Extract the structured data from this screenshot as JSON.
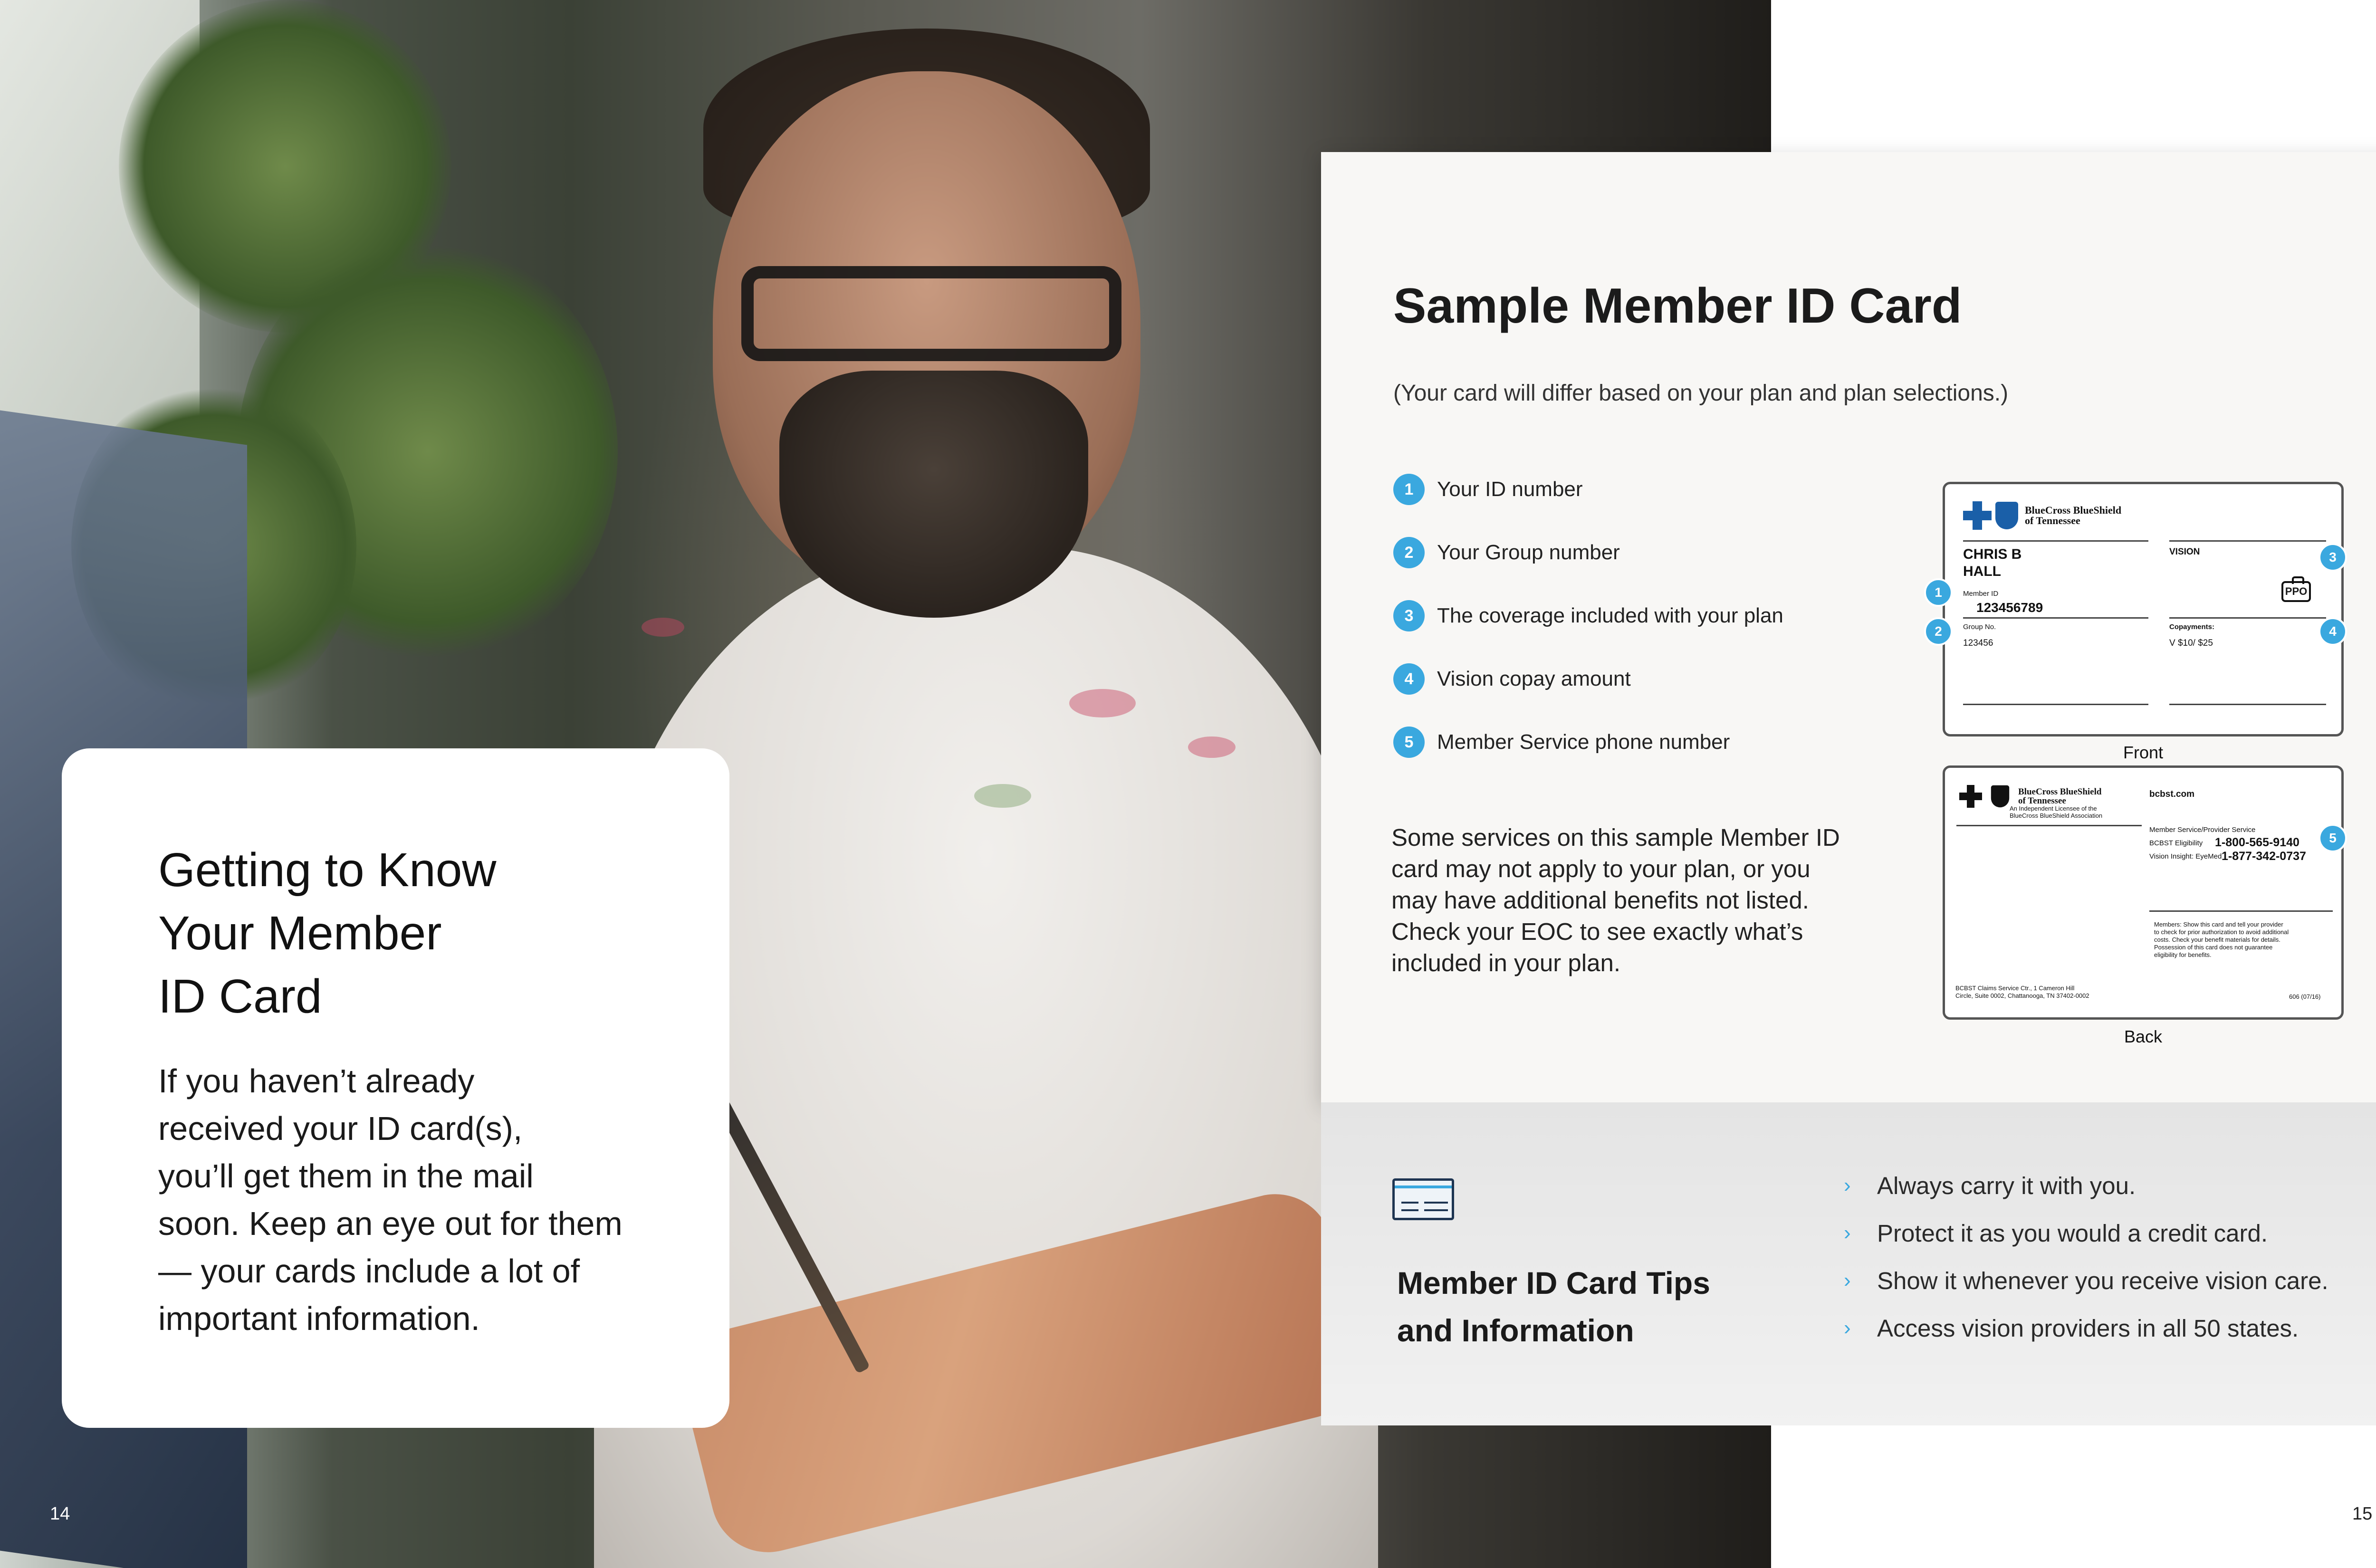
{
  "page_numbers": {
    "left": "14",
    "right": "15"
  },
  "intro": {
    "title": "Getting to Know\nYour Member\nID Card",
    "body": "If you haven’t already\nreceived your ID card(s),\nyou’ll get them in the mail\nsoon. Keep an eye out for them\n— your cards include a lot of\nimportant information."
  },
  "sample": {
    "title": "Sample Member ID Card",
    "subtitle": "(Your card will differ based on your plan and plan selections.)",
    "legend": [
      {
        "num": "1",
        "label": "Your ID number"
      },
      {
        "num": "2",
        "label": "Your Group number"
      },
      {
        "num": "3",
        "label": "The coverage included with your plan"
      },
      {
        "num": "4",
        "label": "Vision copay amount"
      },
      {
        "num": "5",
        "label": "Member Service phone number"
      }
    ],
    "note": "Some services on this sample Member ID\ncard may not apply to your plan, or you\nmay have additional benefits not listed.\nCheck your EOC to see exactly what’s\nincluded in your plan."
  },
  "card_front": {
    "caption": "Front",
    "logo_text": "BlueCross BlueShield\nof Tennessee",
    "member_name": "CHRIS B\nHALL",
    "coverage": "VISION",
    "plan_badge": "PPO",
    "member_id_label": "Member ID",
    "member_id": "123456789",
    "group_label": "Group No.",
    "group_no": "123456",
    "copay_label": "Copayments:",
    "copay_value": "V $10/ $25"
  },
  "card_back": {
    "caption": "Back",
    "logo_text": "BlueCross BlueShield\nof Tennessee",
    "licensee": "An Independent Licensee of the\nBlueCross BlueShield Association",
    "website": "bcbst.com",
    "service_label": "Member Service/Provider Service",
    "eligibility_label": "BCBST Eligibility",
    "eligibility_phone": "1-800-565-9140",
    "vision_label": "Vision Insight: EyeMed",
    "vision_phone": "1-877-342-0737",
    "members_note": "Members: Show this card and tell your provider\nto check for prior authorization to avoid additional\ncosts. Check your benefit materials for details.\nPossession of this card does not guarantee\neligibility for benefits.",
    "address": "BCBST Claims Service Ctr., 1 Cameron Hill\nCircle, Suite 0002, Chattanooga, TN 37402-0002",
    "form_code": "606 (07/16)"
  },
  "tips": {
    "title": "Member ID Card Tips\nand Information",
    "items": [
      "Always carry it with you.",
      "Protect it as you would a credit card.",
      "Show it whenever you receive vision care.",
      "Access vision providers in all 50 states."
    ]
  },
  "colors": {
    "accent": "#3aa8df",
    "brand_blue": "#1a5fa8",
    "navy": "#1e3552"
  }
}
